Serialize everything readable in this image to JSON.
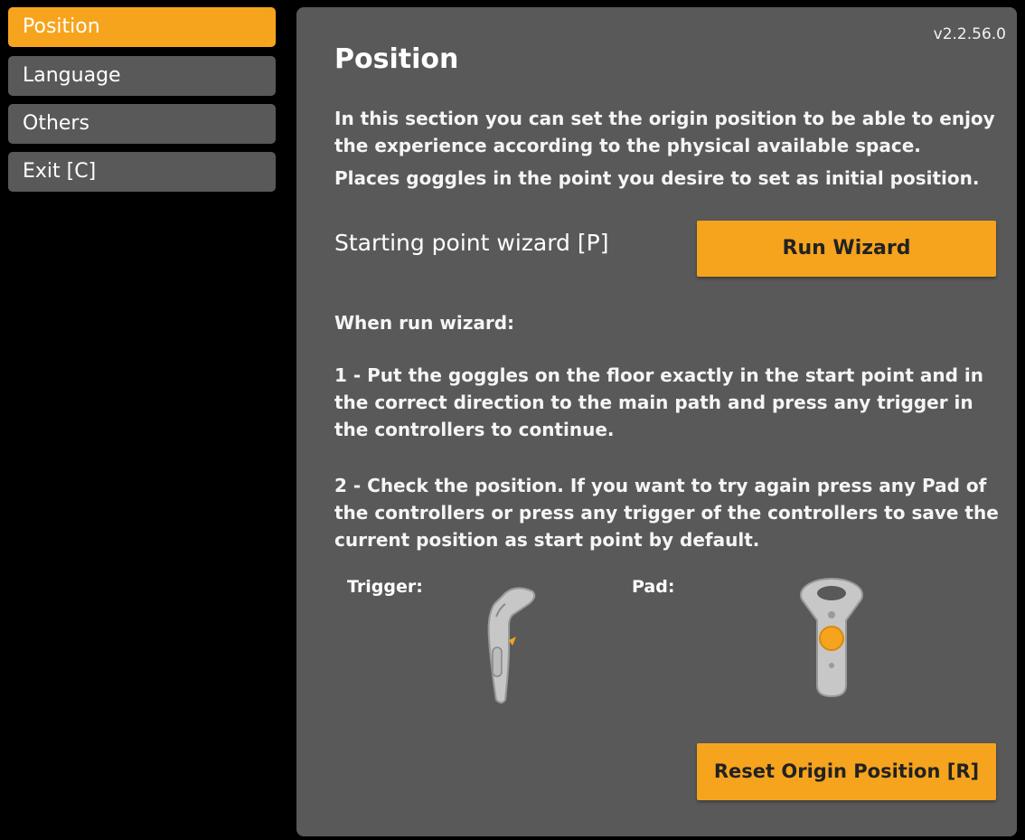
{
  "sidebar": {
    "items": [
      {
        "label": "Position"
      },
      {
        "label": "Language"
      },
      {
        "label": "Others"
      },
      {
        "label": "Exit [C]"
      }
    ]
  },
  "panel": {
    "version": "v2.2.56.0",
    "title": "Position",
    "intro_line1": "In this section you can set the origin position to be able to enjoy the experience according to the physical available space.",
    "intro_line2": "Places goggles in the point you desire to set as initial position.",
    "wizard_label": "Starting point wizard [P]",
    "run_wizard_button": "Run Wizard",
    "when_run": "When run wizard:",
    "step1": "1 - Put the goggles on the floor exactly in the start point and in the correct direction to the main path and press any trigger in the controllers to continue.",
    "step2": "2 - Check the position. If you want to try again press any Pad of the controllers or press any trigger of the controllers to save the current position as start point by default.",
    "trigger_label": "Trigger:",
    "pad_label": "Pad:",
    "reset_button": "Reset Origin Position [R]"
  },
  "colors": {
    "accent": "#f6a41d",
    "panel_bg": "#595959",
    "background": "#000000"
  },
  "icons": [
    "controller-trigger-icon",
    "controller-pad-icon"
  ]
}
